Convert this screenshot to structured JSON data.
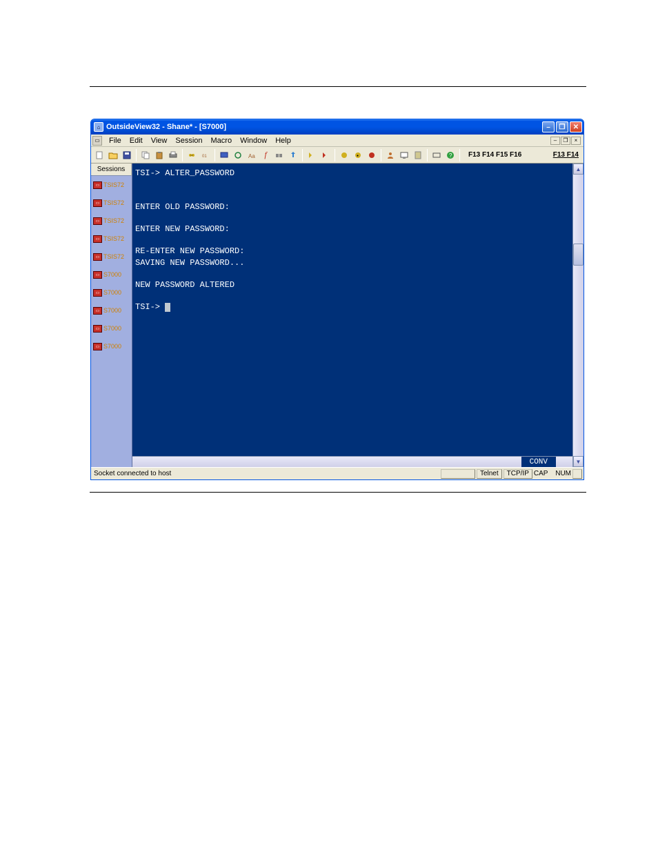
{
  "titlebar": {
    "title": "OutsideView32 - Shane* - [S7000]"
  },
  "menubar": {
    "items": [
      "File",
      "Edit",
      "View",
      "Session",
      "Macro",
      "Window",
      "Help"
    ]
  },
  "toolbar": {
    "fkeys_left": "F13 F14 F15 F16",
    "fkeys_right": "F13 F14",
    "icons": [
      "new",
      "open",
      "save",
      "copy",
      "paste",
      "print",
      "connect",
      "settings",
      "screen",
      "loop",
      "font",
      "fx",
      "keys",
      "upload",
      "run1",
      "run2",
      "run3",
      "run4",
      "run5",
      "user",
      "monitor",
      "pc",
      "rect",
      "help"
    ]
  },
  "sessions": {
    "header": "Sessions",
    "items": [
      "TSIS72",
      "TSIS72",
      "TSIS72",
      "TSIS72",
      "TSIS72",
      "S7000",
      "S7000",
      "S7000",
      "S7000",
      "S7000"
    ]
  },
  "terminal": {
    "lines": [
      "TSI-> ALTER_PASSWORD",
      "",
      "",
      "ENTER OLD PASSWORD:",
      "",
      "ENTER NEW PASSWORD:",
      "",
      "RE-ENTER NEW PASSWORD:",
      "SAVING NEW PASSWORD...",
      "",
      "NEW PASSWORD ALTERED",
      "",
      "TSI-> "
    ],
    "mode_label": "CONV"
  },
  "statusbar": {
    "message": "Socket connected to host",
    "connection": "Telnet",
    "protocol": "TCP/IP",
    "caps": "CAP",
    "num": "NUM"
  }
}
